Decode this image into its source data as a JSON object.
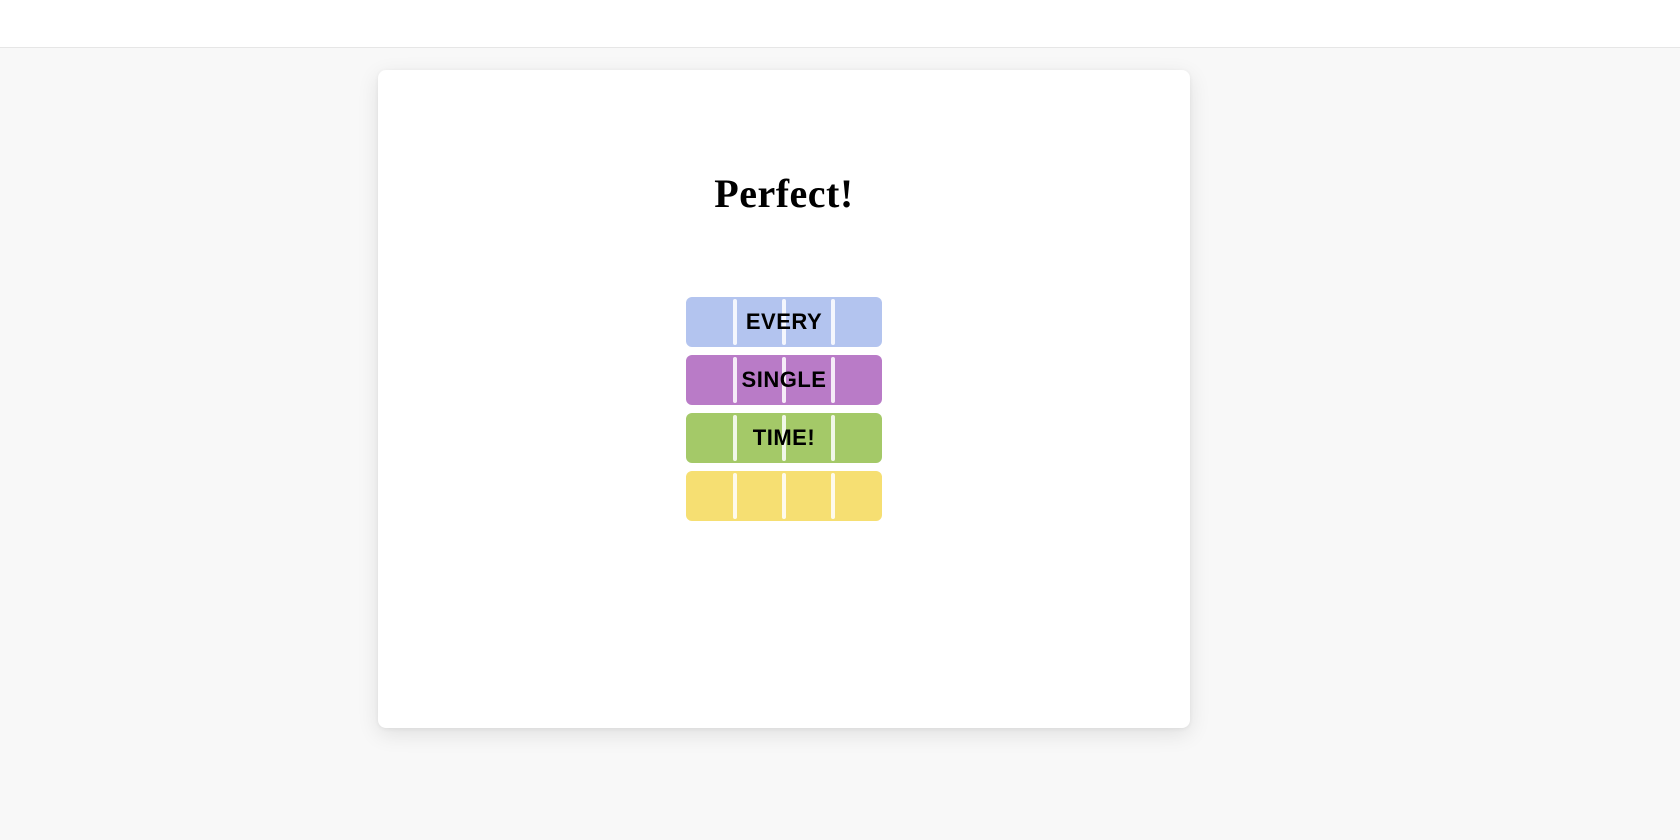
{
  "modal": {
    "headline": "Perfect!",
    "rows": [
      {
        "label": "EVERY",
        "color": "#b3c4ef"
      },
      {
        "label": "SINGLE",
        "color": "#b97bc7"
      },
      {
        "label": "TIME!",
        "color": "#a4c968"
      },
      {
        "label": "",
        "color": "#f6df72"
      }
    ]
  }
}
